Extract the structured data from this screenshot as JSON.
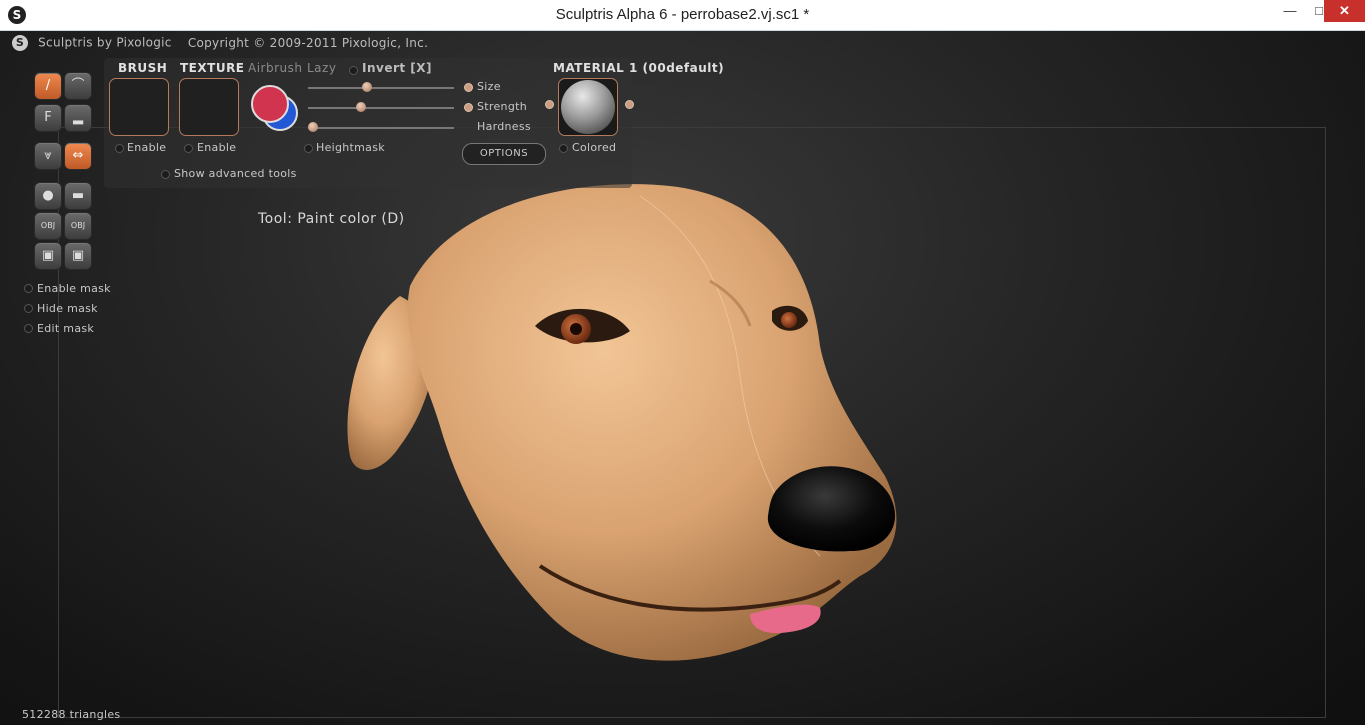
{
  "window": {
    "title": "Sculptris Alpha 6 - perrobase2.vj.sc1 *",
    "minimize_glyph": "—",
    "maximize_glyph": "□",
    "close_glyph": "✕"
  },
  "header": {
    "app_name": "Sculptris by Pixologic",
    "copyright": "Copyright © 2009-2011 Pixologic, Inc."
  },
  "tools": [
    {
      "name": "paint-brush-tool",
      "icon": "brush-icon",
      "glyph": "/",
      "active": true
    },
    {
      "name": "bump-tool",
      "icon": "bump-icon",
      "glyph": "⌒",
      "active": false
    },
    {
      "name": "flatten-tool",
      "icon": "f-icon",
      "glyph": "F",
      "active": false
    },
    {
      "name": "smooth-tool",
      "icon": "smooth-icon",
      "glyph": "▂",
      "active": false
    },
    {
      "name": "symmetry-tool",
      "icon": "symmetry-icon",
      "glyph": "⩔",
      "active": false
    },
    {
      "name": "symmetry-arrows-tool",
      "icon": "arrows-icon",
      "glyph": "⇔",
      "active": true
    },
    {
      "name": "sphere-tool",
      "icon": "sphere-icon",
      "glyph": "●",
      "active": false
    },
    {
      "name": "plane-tool",
      "icon": "plane-icon",
      "glyph": "▬",
      "active": false
    },
    {
      "name": "import-obj-button",
      "icon": "import-obj-icon",
      "glyph": "OBJ",
      "active": false
    },
    {
      "name": "export-obj-button",
      "icon": "export-obj-icon",
      "glyph": "OBJ",
      "active": false
    },
    {
      "name": "save-button",
      "icon": "save-icon",
      "glyph": "▣",
      "active": false
    },
    {
      "name": "save-as-button",
      "icon": "save-as-icon",
      "glyph": "▣",
      "active": false
    }
  ],
  "mask": {
    "enable": "Enable mask",
    "hide": "Hide mask",
    "edit": "Edit mask"
  },
  "panel": {
    "brush_label": "BRUSH",
    "texture_label": "TEXTURE",
    "airbrush_label": "Airbrush",
    "lazy_label": "Lazy",
    "invert_label": "Invert [X]",
    "brush_enable": "Enable",
    "texture_enable": "Enable",
    "size_label": "Size",
    "strength_label": "Strength",
    "hardness_label": "Hardness",
    "heightmask_label": "Heightmask",
    "options_label": "OPTIONS",
    "advanced_label": "Show advanced tools",
    "size_value": 0.4,
    "strength_value": 0.35,
    "hardness_value": 0.0,
    "primary_color": "#d0344f",
    "secondary_color": "#2258d6"
  },
  "material": {
    "title": "MATERIAL 1 (00default)",
    "colored_label": "Colored"
  },
  "tool_status": "Tool: Paint color (D)",
  "status_bar": "512288 triangles"
}
